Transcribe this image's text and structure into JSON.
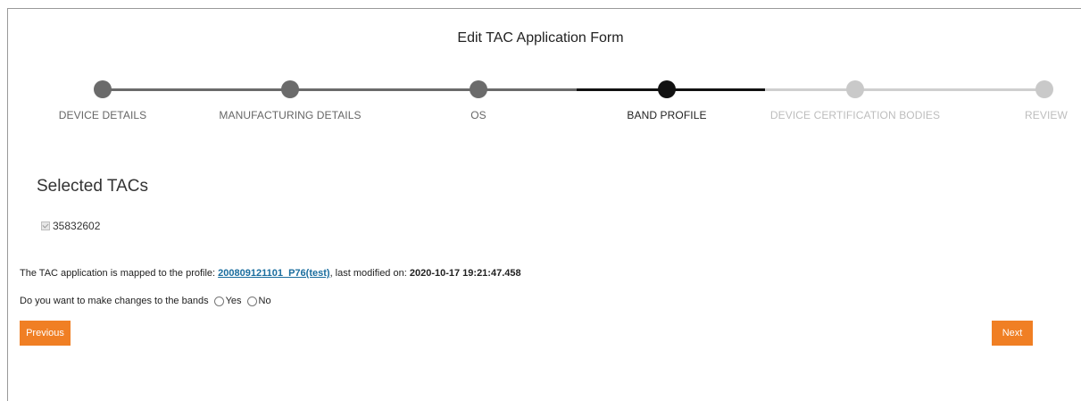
{
  "form": {
    "title": "Edit TAC Application Form"
  },
  "stepper": {
    "steps": [
      {
        "label": "DEVICE DETAILS",
        "state": "completed"
      },
      {
        "label": "MANUFACTURING DETAILS",
        "state": "completed"
      },
      {
        "label": "OS",
        "state": "completed"
      },
      {
        "label": "BAND PROFILE",
        "state": "active"
      },
      {
        "label": "DEVICE CERTIFICATION BODIES",
        "state": "pending"
      },
      {
        "label": "REVIEW",
        "state": "pending"
      }
    ],
    "colors": {
      "completed": "#6b6b6b",
      "active": "#111111",
      "pending": "#c9c9c9",
      "completed_text": "#666666",
      "active_text": "#222222",
      "pending_text": "#bdbdbd"
    }
  },
  "selected_tacs": {
    "heading": "Selected TACs",
    "items": [
      {
        "value": "35832602",
        "checked": true,
        "disabled": true
      }
    ]
  },
  "mapping": {
    "prefix": "The TAC application is mapped to the profile: ",
    "profile_link": "200809121101_P76(test)",
    "middle": ", last modified on: ",
    "modified": "2020-10-17 19:21:47.458"
  },
  "bands_question": {
    "label": "Do you want to make changes to the bands",
    "options": [
      "Yes",
      "No"
    ]
  },
  "buttons": {
    "previous": "Previous",
    "next": "Next",
    "color": "#f07f24"
  }
}
